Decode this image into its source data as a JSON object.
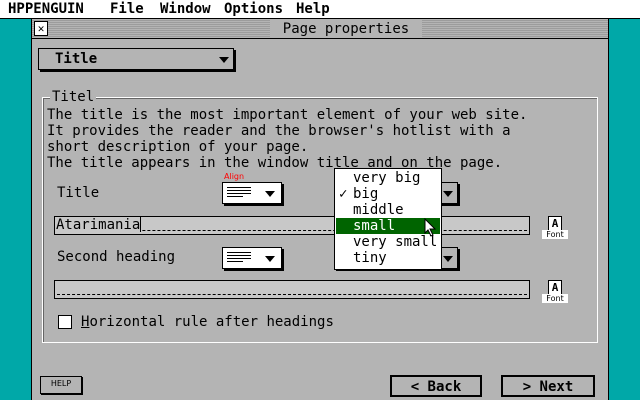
{
  "menubar": {
    "items": [
      "HPPENGUIN",
      "File",
      "Window",
      "Options",
      "Help"
    ]
  },
  "window": {
    "title": "Page properties",
    "section_select": "Title"
  },
  "group": {
    "label": "Titel",
    "description": [
      "The title is the most important element of your web site.",
      "It provides the reader and the browser's hotlist with a",
      "short description of your page.",
      "The title appears in the window title and on the page."
    ]
  },
  "title_row": {
    "label": "Title",
    "align_label": "Align",
    "title_value": "Atarimania",
    "font_label": "Font"
  },
  "second_row": {
    "label": "Second heading",
    "second_value": "",
    "font_label": "Font"
  },
  "size_dropdown": {
    "options": [
      "very big",
      "big",
      "middle",
      "small",
      "very small",
      "tiny"
    ],
    "checked": "big",
    "highlighted": "small"
  },
  "checkbox": {
    "label": "Horizontal rule after headings",
    "checked": false
  },
  "footer": {
    "help_label": "HELP",
    "back_label": "< Back",
    "next_label": "> Next"
  },
  "colors": {
    "desktop": "#00a8a8",
    "window": "#b4b4b4",
    "highlight": "#006400",
    "align_label": "#ff0000"
  }
}
